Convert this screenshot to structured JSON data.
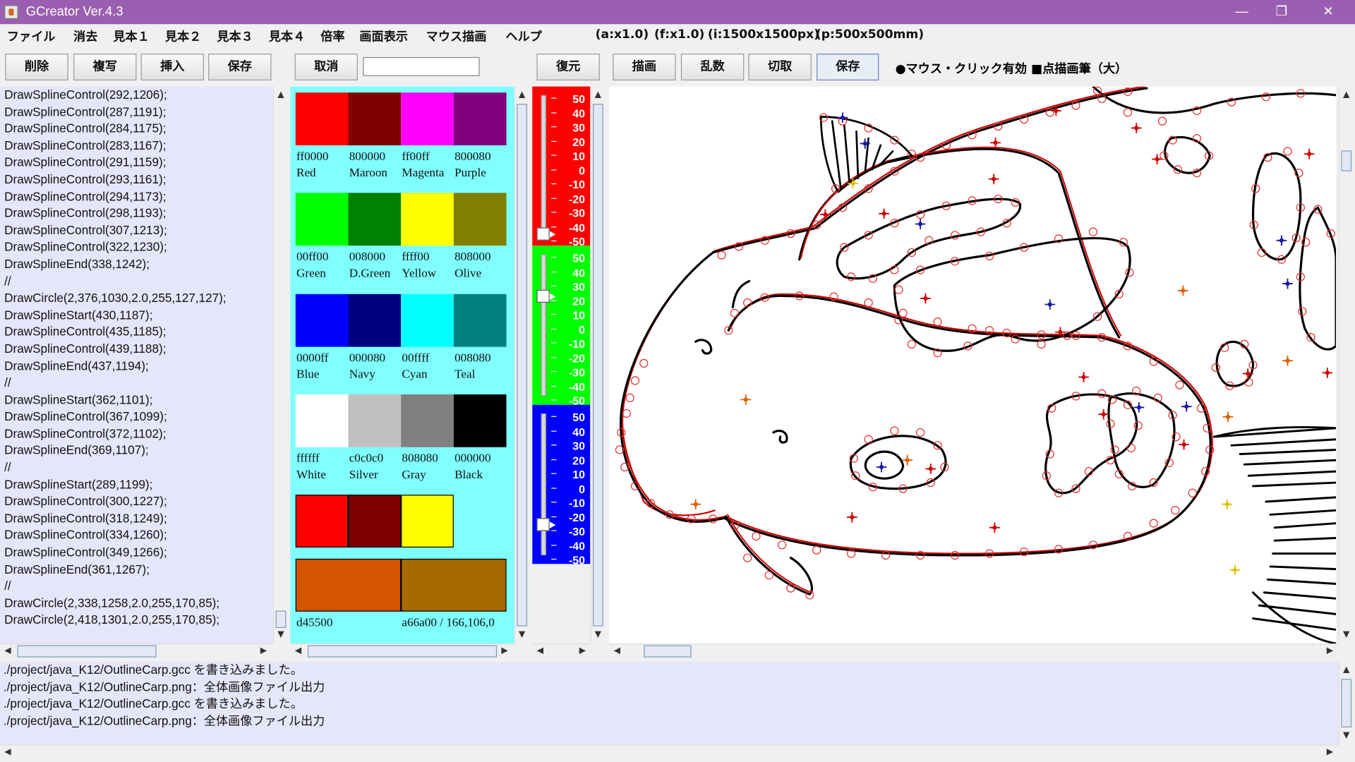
{
  "window": {
    "title": "GCreator  Ver.4.3",
    "minimize_glyph": "—",
    "maximize_glyph": "❐",
    "close_glyph": "✕"
  },
  "menu": [
    "ファイル",
    "消去",
    "見本１",
    "見本２",
    "見本３",
    "見本４",
    "倍率",
    "画面表示",
    "マウス描画",
    "ヘルプ"
  ],
  "status": {
    "a": "(a:x1.0)",
    "f": "(f:x1.0)",
    "i": "(i:1500x1500px)",
    "p": "(p:500x500mm)"
  },
  "toolbar": {
    "delete": "削除",
    "copy": "複写",
    "insert": "挿入",
    "save1": "保存",
    "undo": "取消",
    "input_value": "",
    "restore": "復元",
    "draw": "描画",
    "random": "乱数",
    "cut": "切取",
    "save2": "保存",
    "mode_text": "●マウス・クリック有効 ■点描画筆（大）"
  },
  "code_lines": [
    "DrawSplineControl(292,1206);",
    "DrawSplineControl(287,1191);",
    "DrawSplineControl(284,1175);",
    "DrawSplineControl(283,1167);",
    "DrawSplineControl(291,1159);",
    "DrawSplineControl(293,1161);",
    "DrawSplineControl(294,1173);",
    "DrawSplineControl(298,1193);",
    "DrawSplineControl(307,1213);",
    "DrawSplineControl(322,1230);",
    "DrawSplineEnd(338,1242);",
    "//",
    "DrawCircle(2,376,1030,2.0,255,127,127);",
    "DrawSplineStart(430,1187);",
    "DrawSplineControl(435,1185);",
    "DrawSplineControl(439,1188);",
    "DrawSplineEnd(437,1194);",
    "//",
    "DrawSplineStart(362,1101);",
    "DrawSplineControl(367,1099);",
    "DrawSplineControl(372,1102);",
    "DrawSplineEnd(369,1107);",
    "//",
    "DrawSplineStart(289,1199);",
    "DrawSplineControl(300,1227);",
    "DrawSplineControl(318,1249);",
    "DrawSplineControl(334,1260);",
    "DrawSplineControl(349,1266);",
    "DrawSplineEnd(361,1267);",
    "//",
    "DrawCircle(2,338,1258,2.0,255,170,85);",
    "DrawCircle(2,418,1301,2.0,255,170,85);"
  ],
  "palette": [
    {
      "hex": "ff0000",
      "name": "Red",
      "color": "#ff0000"
    },
    {
      "hex": "800000",
      "name": "Maroon",
      "color": "#800000"
    },
    {
      "hex": "ff00ff",
      "name": "Magenta",
      "color": "#ff00ff"
    },
    {
      "hex": "800080",
      "name": "Purple",
      "color": "#800080"
    },
    {
      "hex": "00ff00",
      "name": "Green",
      "color": "#00ff00"
    },
    {
      "hex": "008000",
      "name": "D.Green",
      "color": "#008000"
    },
    {
      "hex": "ffff00",
      "name": "Yellow",
      "color": "#ffff00"
    },
    {
      "hex": "808000",
      "name": "Olive",
      "color": "#808000"
    },
    {
      "hex": "0000ff",
      "name": "Blue",
      "color": "#0000ff"
    },
    {
      "hex": "000080",
      "name": "Navy",
      "color": "#000080"
    },
    {
      "hex": "00ffff",
      "name": "Cyan",
      "color": "#00ffff"
    },
    {
      "hex": "008080",
      "name": "Teal",
      "color": "#008080"
    },
    {
      "hex": "ffffff",
      "name": "White",
      "color": "#ffffff"
    },
    {
      "hex": "c0c0c0",
      "name": "Silver",
      "color": "#c0c0c0"
    },
    {
      "hex": "808080",
      "name": "Gray",
      "color": "#808080"
    },
    {
      "hex": "000000",
      "name": "Black",
      "color": "#000000"
    }
  ],
  "recent_colors": [
    "#ff0000",
    "#800000",
    "#ffff00"
  ],
  "current_colors": {
    "left_color": "#d45500",
    "left_label": "d45500",
    "right_color": "#a66a00",
    "right_label": "a66a00 / 166,106,0"
  },
  "sliders": {
    "ticks": [
      "50",
      "40",
      "30",
      "20",
      "10",
      "0",
      "-10",
      "-20",
      "-30",
      "-40",
      "-50"
    ],
    "red": {
      "color": "#ff0000",
      "value": -50
    },
    "green": {
      "color": "#00ff00",
      "value": 20
    },
    "blue": {
      "color": "#0000ff",
      "value": -30
    }
  },
  "log_lines": [
    "./project/java_K12/OutlineCarp.gcc を書き込みました。",
    "./project/java_K12/OutlineCarp.png：全体画像ファイル出力",
    "./project/java_K12/OutlineCarp.gcc を書き込みました。",
    "./project/java_K12/OutlineCarp.png：全体画像ファイル出力"
  ]
}
